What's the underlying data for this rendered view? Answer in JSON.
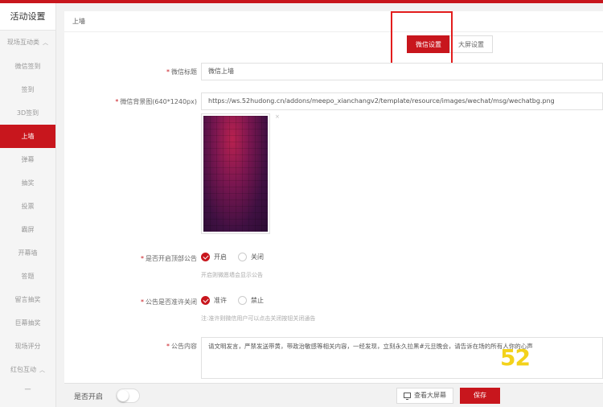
{
  "colors": {
    "accent": "#c8161d",
    "highlight": "#e31d1d",
    "watermark": "#f3d21b"
  },
  "sidebar": {
    "title": "活动设置",
    "group1": "现场互动类",
    "items": [
      "微信签到",
      "签到",
      "3D签到",
      "上墙",
      "弹幕",
      "抽奖",
      "投票",
      "霸屏",
      "开幕墙",
      "答题",
      "留言抽奖",
      "巨幕抽奖",
      "现场评分"
    ],
    "active_index": 3,
    "group2": "红包互动",
    "dash": "一"
  },
  "header": {
    "title": "上墙"
  },
  "tabs": {
    "wechat": "微信设置",
    "screen": "大屏设置"
  },
  "form": {
    "title_label": "微信标题",
    "title_value": "微信上墙",
    "bg_label": "微信背景图(640*1240px)",
    "bg_value": "https://ws.52hudong.cn/addons/meepo_xianchangv2/template/resource/images/wechat/msg/wechatbg.png",
    "bg_close": "×",
    "notice_label": "是否开启顶部公告",
    "notice_on": "开启",
    "notice_off": "关闭",
    "notice_hint": "开启则微愿墙会显示公告",
    "close_label": "公告是否准许关闭",
    "close_allow": "准许",
    "close_forbid": "禁止",
    "close_hint": "注:准许则微信用户可以点击关闭按钮关闭通告",
    "content_label": "公告内容",
    "content_value": "请文明发言，严禁发送带黄，带政治敏感等相关内容，一经发现，立刻永久拉黑#元旦晚会，请告诉在场的所有人你的心声"
  },
  "watermark": "52",
  "bottom": {
    "enable_label": "是否开启",
    "view_screen": "查看大屏幕",
    "save": "保存"
  }
}
